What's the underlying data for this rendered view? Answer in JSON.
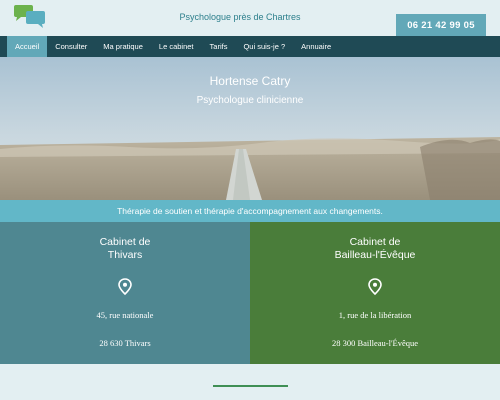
{
  "header": {
    "tagline": "Psychologue près de Chartres",
    "phone": "06 21 42 99 05"
  },
  "nav": {
    "items": [
      {
        "label": "Accueil",
        "active": true
      },
      {
        "label": "Consulter"
      },
      {
        "label": "Ma pratique"
      },
      {
        "label": "Le cabinet"
      },
      {
        "label": "Tarifs"
      },
      {
        "label": "Qui suis-je ?"
      },
      {
        "label": "Annuaire"
      }
    ]
  },
  "hero": {
    "name": "Hortense Catry",
    "subtitle": "Psychologue clinicienne"
  },
  "banner": {
    "text": "Thérapie de soutien et thérapie d'accompagnement aux changements."
  },
  "cabinets": [
    {
      "title_line1": "Cabinet de",
      "title_line2": "Thivars",
      "address": "45, rue nationale",
      "city": "28 630 Thivars",
      "color": "#4f8791"
    },
    {
      "title_line1": "Cabinet de",
      "title_line2": "Bailleau-l'Évêque",
      "address": "1, rue de la libération",
      "city": "28 300 Bailleau-l'Évêque",
      "color": "#4a7d3a"
    }
  ],
  "colors": {
    "nav_bg": "#1f4a55",
    "accent": "#62a8b8",
    "banner": "#62b7c8",
    "footer_line": "#3f8f55"
  },
  "icons": {
    "logo": "speech-bubbles-icon",
    "location": "map-pin-icon"
  }
}
